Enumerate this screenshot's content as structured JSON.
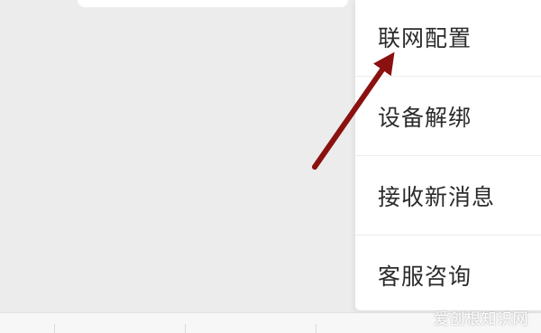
{
  "menu": {
    "items": [
      {
        "label": "联网配置"
      },
      {
        "label": "设备解绑"
      },
      {
        "label": "接收新消息"
      },
      {
        "label": "客服咨询"
      }
    ]
  },
  "watermark": {
    "text": "爱创根知识网"
  },
  "colors": {
    "background": "#ececec",
    "menu_background": "#ffffff",
    "arrow": "#8b1010",
    "text": "#2b2b2b"
  },
  "icons": {
    "annotation": "arrow-up-right-icon"
  }
}
